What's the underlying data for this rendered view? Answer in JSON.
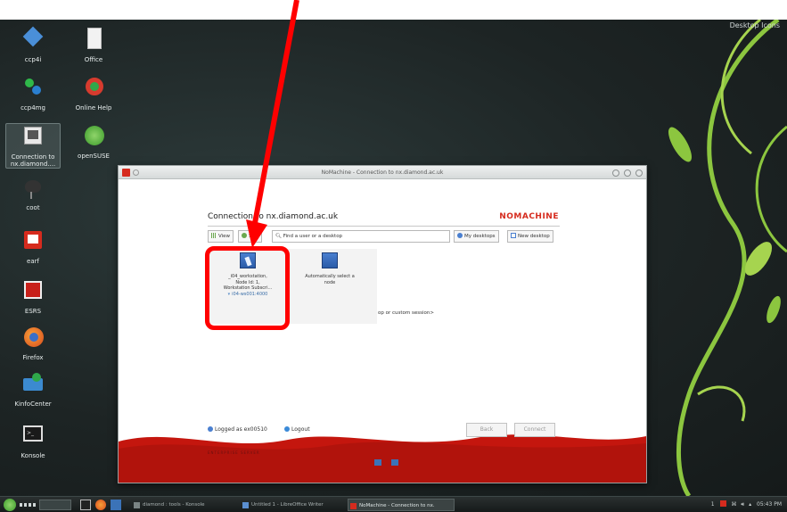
{
  "desktop": {
    "corner_label": "Desktop Icons",
    "icons": [
      {
        "label": "ccp4i"
      },
      {
        "label": "Office"
      },
      {
        "label": "ccp4mg"
      },
      {
        "label": "Online Help"
      },
      {
        "label": "Connection to nx.diamond...."
      },
      {
        "label": "openSUSE"
      },
      {
        "label": "coot"
      },
      {
        "label": "earf"
      },
      {
        "label": "ESRS"
      },
      {
        "label": "Firefox"
      },
      {
        "label": "KinfoCenter"
      },
      {
        "label": "Konsole"
      }
    ]
  },
  "window": {
    "title": "NoMachine - Connection to nx.diamond.ac.uk",
    "connection_title": "Connection to nx.diamond.ac.uk",
    "brand": "NOMACHINE",
    "toolbar": {
      "view_label": "View",
      "sort_label": "Sort",
      "search_placeholder": "Find a user or a desktop",
      "my_desktops_label": "My desktops",
      "new_desktop_label": "New desktop"
    },
    "tiles": [
      {
        "line1": "_i04_workstation,",
        "line2": "Node Id: 1,",
        "line3": "Workstation Subscri...",
        "host": "i04-ws001:4000"
      },
      {
        "line1": "Automatically select a",
        "line2": "node"
      }
    ],
    "custom_session_link": "op or custom session>",
    "logged_as": "Logged as ex00510",
    "logout_label": "Logout",
    "back_label": "Back",
    "connect_label": "Connect",
    "footer_text": "ENTERPRISE SERVER"
  },
  "taskbar": {
    "tasks": [
      {
        "label": "diamond : tools - Konsole"
      },
      {
        "label": "Untitled 1 - LibreOffice Writer"
      },
      {
        "label": "NoMachine - Connection to nx."
      }
    ],
    "tray_page": "1",
    "clock": "05:43 PM"
  },
  "colors": {
    "annotation": "#ff0000",
    "brand_red": "#d62b1e",
    "vine_green": "#8cc63f"
  }
}
